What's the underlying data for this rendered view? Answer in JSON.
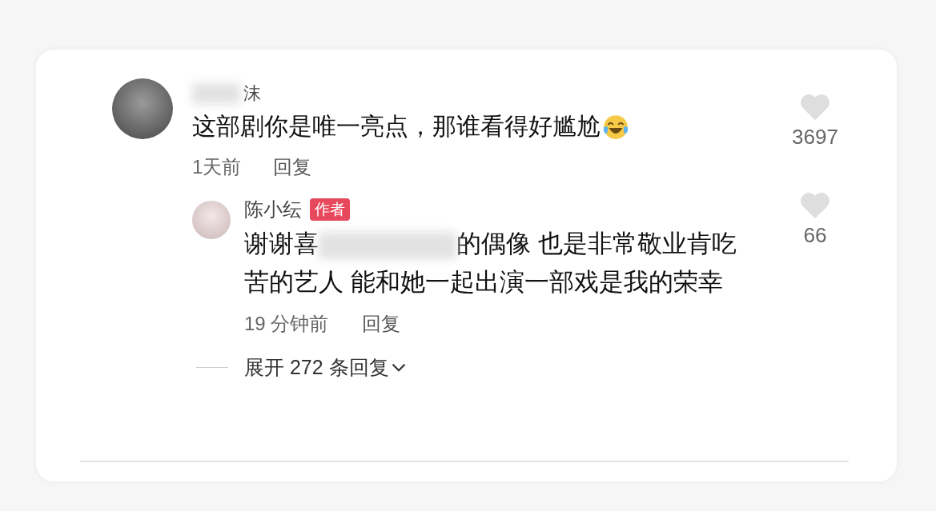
{
  "comment": {
    "author": "沫",
    "author_blurred": true,
    "text": "这部剧你是唯一亮点，那谁看得好尴尬",
    "time": "1天前",
    "reply_label": "回复",
    "likes": "3697"
  },
  "reply": {
    "author": "陈小纭",
    "badge": "作者",
    "text_before_blur": "谢谢喜",
    "text_after_blur": "的偶像 也是非常敬业肯吃苦的艺人 能和她一起出演一部戏是我的荣幸",
    "time": "19 分钟前",
    "reply_label": "回复",
    "likes": "66"
  },
  "expand": {
    "label": "展开 272 条回复"
  }
}
